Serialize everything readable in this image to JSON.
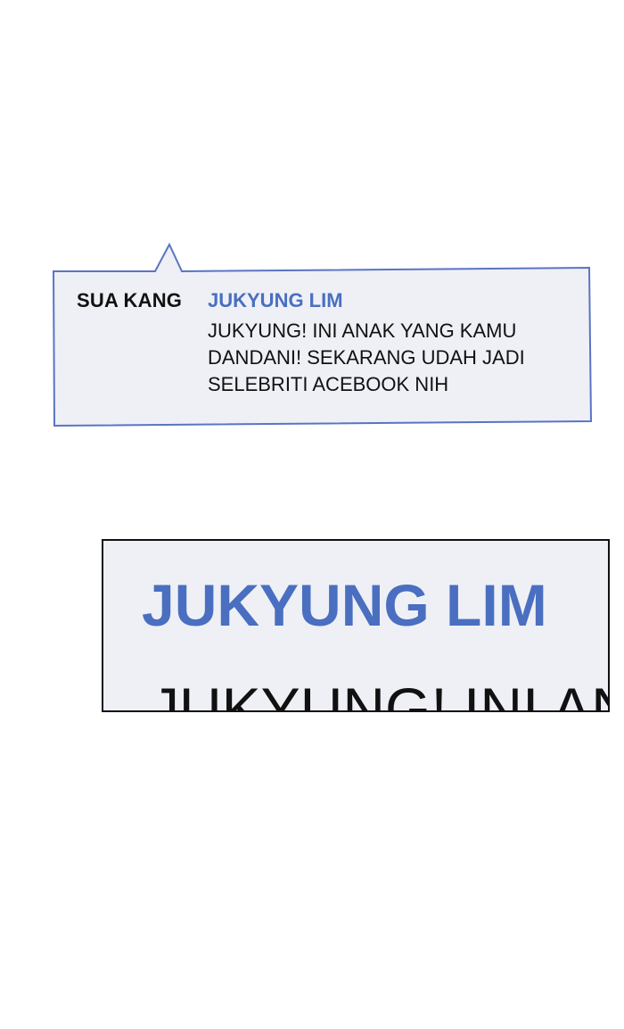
{
  "bubble": {
    "sender": "SUA KANG",
    "contact_name": "JUKYUNG LIM",
    "message": "JUKYUNG! INI ANAK YANG KAMU DANDANI! SEKARANG UDAH JADI SELEBRITI ACEBOOK NIH"
  },
  "zoom_panel": {
    "contact_name": "JUKYUNG LIM",
    "message_fragment": "JUKYUNG! INI AN"
  },
  "colors": {
    "accent_blue": "#4a6fc0",
    "bubble_fill": "#eef0f6",
    "bubble_border": "#5a74c4",
    "text_dark": "#111111"
  }
}
